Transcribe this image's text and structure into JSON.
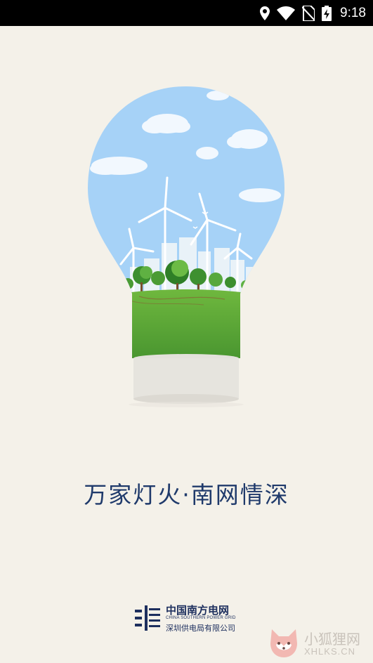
{
  "status_bar": {
    "time": "9:18",
    "icons": [
      "location-icon",
      "wifi-icon",
      "no-sim-icon",
      "battery-charging-icon"
    ]
  },
  "splash": {
    "illustration": "lightbulb-wind-city-icon",
    "slogan": "万家灯火·南网情深"
  },
  "footer": {
    "logo_icon": "csg-logo-icon",
    "company_name": "中国南方电网",
    "company_name_en": "CHINA SOUTHERN POWER GRID",
    "subsidiary": "深圳供电局有限公司"
  },
  "watermark": {
    "brand": "小狐狸网",
    "domain": "XHLKS.CN",
    "icon": "fox-icon"
  },
  "colors": {
    "background": "#f4f1e9",
    "sky": "#a6d2f7",
    "grass": "#4f9f35",
    "slogan": "#1f3a6b"
  }
}
